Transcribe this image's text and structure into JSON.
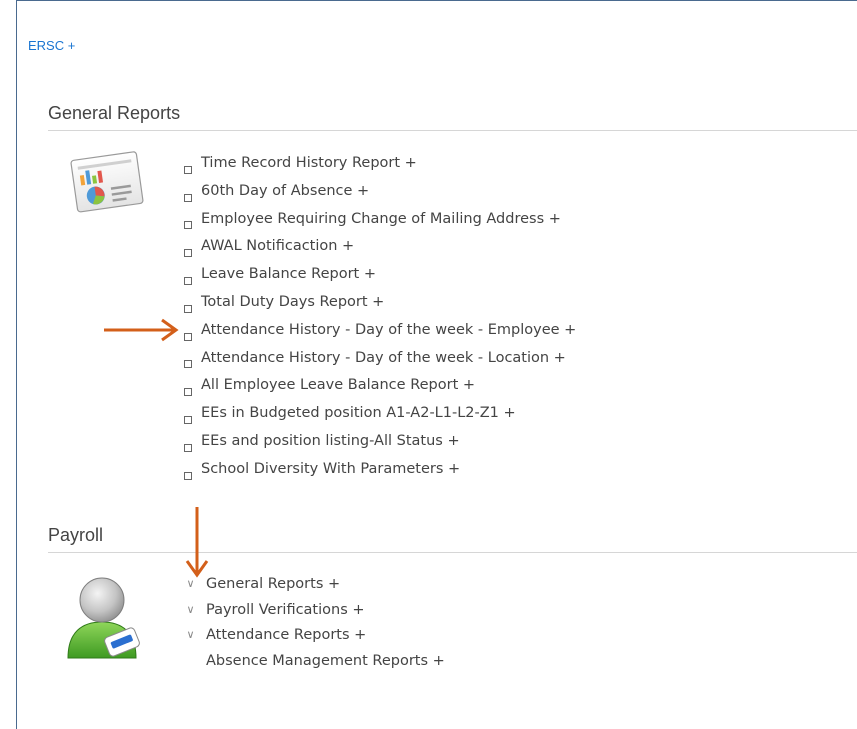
{
  "top_link": "ERSC +",
  "general_reports": {
    "title": "General Reports",
    "icon": "report-chart-icon",
    "items": [
      {
        "label": "Time Record History Report +"
      },
      {
        "label": "60th Day of Absence +"
      },
      {
        "label": "Employee Requiring Change of Mailing Address +"
      },
      {
        "label": "AWAL Notificaction +"
      },
      {
        "label": "Leave Balance Report +"
      },
      {
        "label": "Total Duty Days Report +"
      },
      {
        "label": "Attendance History - Day of the week - Employee +"
      },
      {
        "label": "Attendance History - Day of the week - Location +"
      },
      {
        "label": "All Employee Leave Balance Report +"
      },
      {
        "label": "EEs in Budgeted position A1-A2-L1-L2-Z1 +"
      },
      {
        "label": "EEs and position listing-All Status +"
      },
      {
        "label": "School Diversity With Parameters +"
      }
    ]
  },
  "payroll": {
    "title": "Payroll",
    "icon": "user-badge-icon",
    "items": [
      {
        "label": "General Reports +",
        "icon": "chevron-down-icon"
      },
      {
        "label": "Payroll Verifications +",
        "icon": "chevron-down-icon"
      },
      {
        "label": "Attendance Reports +",
        "icon": "chevron-down-icon"
      },
      {
        "label": "Absence Management Reports +",
        "icon": null
      }
    ]
  },
  "colors": {
    "link": "#1a75d1",
    "annotation_arrow": "#d35f1a",
    "frame_border": "#4a6a8f"
  }
}
